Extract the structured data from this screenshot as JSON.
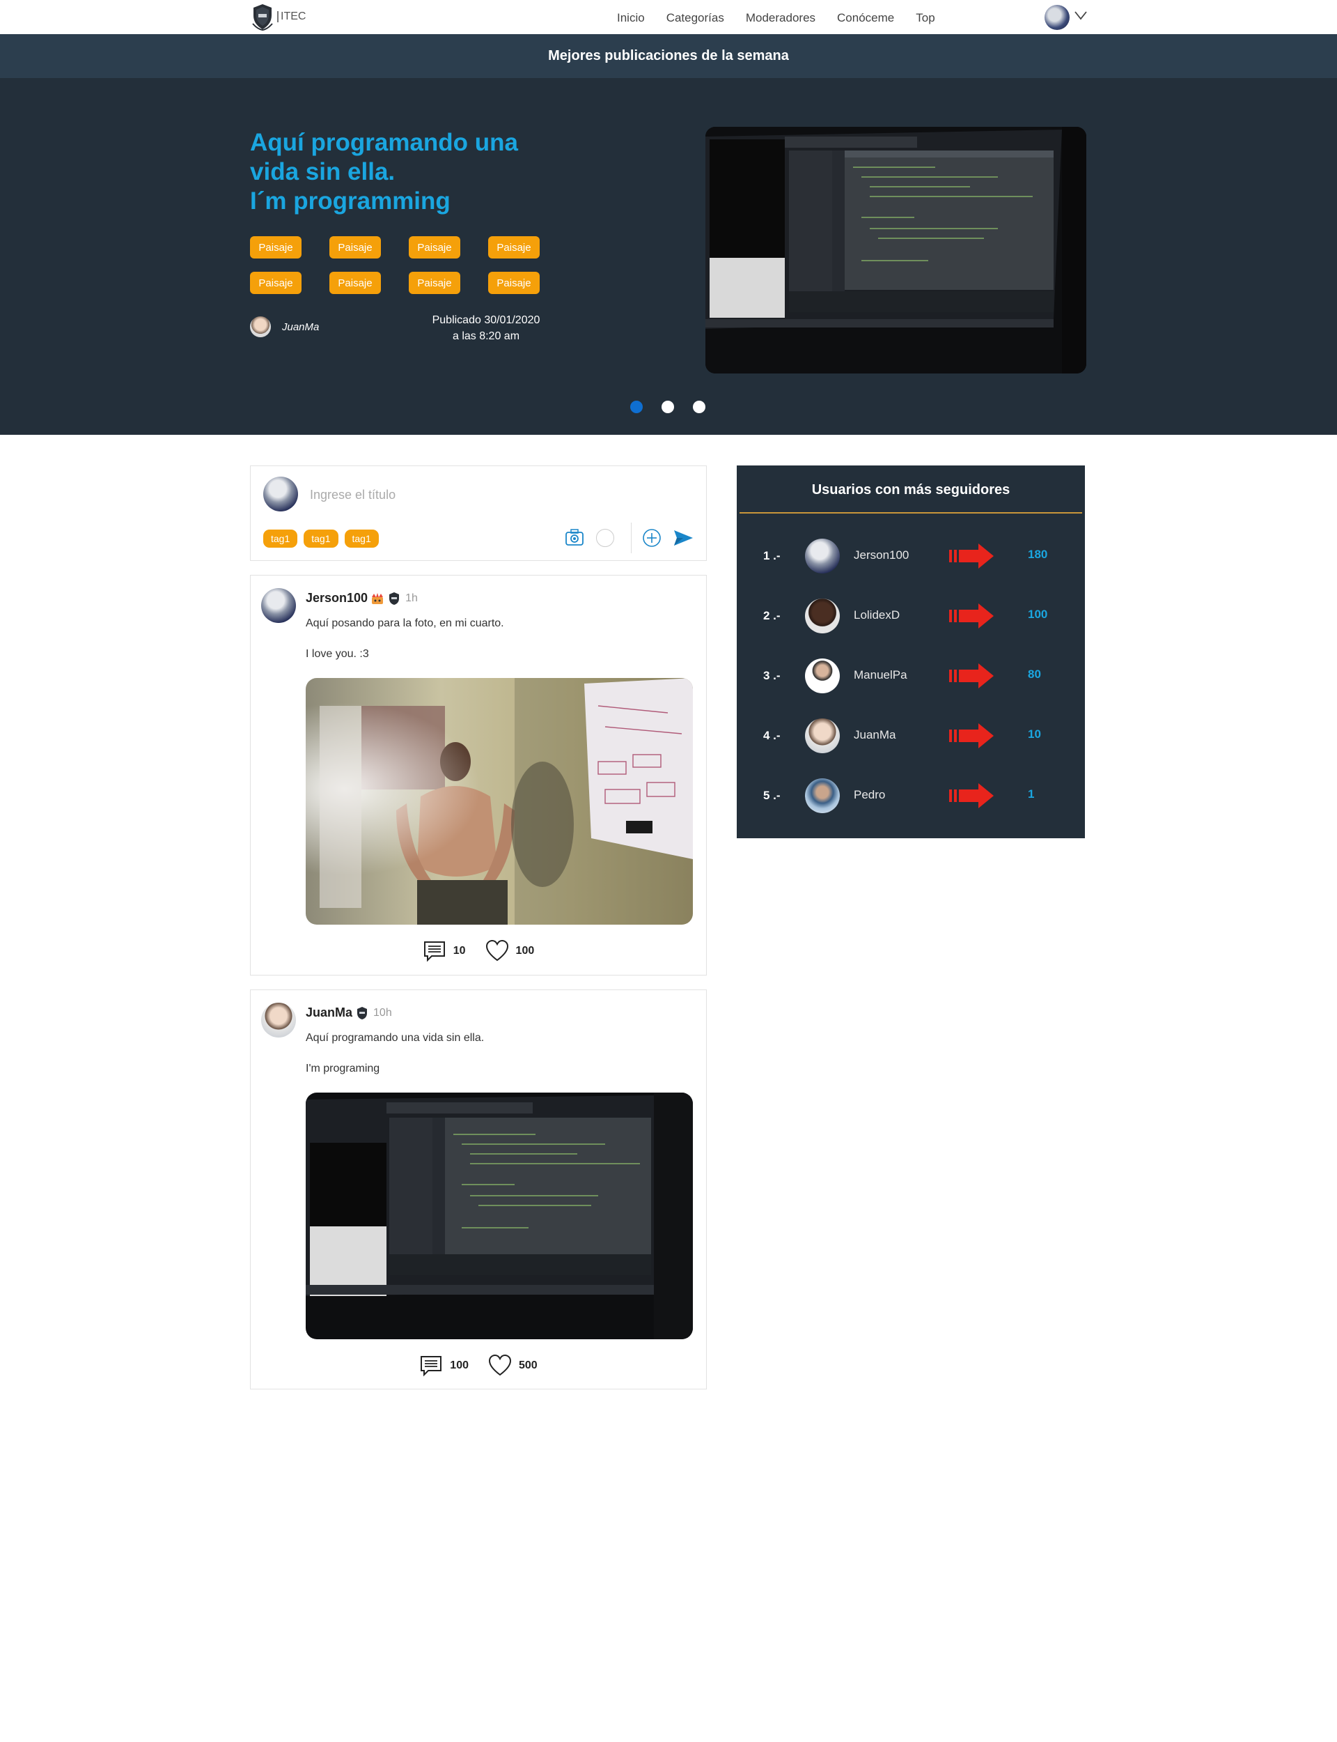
{
  "brand": {
    "logo_text": "ITEC"
  },
  "nav": {
    "links": [
      "Inicio",
      "Categorías",
      "Moderadores",
      "Conóceme",
      "Top"
    ]
  },
  "hero": {
    "bar_title": "Mejores publicaciones de la semana",
    "title_lines": [
      "Aquí programando una",
      "vida sin ella.",
      "I´m programming"
    ],
    "tags": [
      "Paisaje",
      "Paisaje",
      "Paisaje",
      "Paisaje",
      "Paisaje",
      "Paisaje",
      "Paisaje",
      "Paisaje"
    ],
    "author": "JuanMa",
    "date_line1": "Publicado 30/01/2020",
    "date_line2": "a las 8:20 am",
    "slides_count": 3,
    "active_slide": 1
  },
  "composer": {
    "placeholder": "Ingrese el título",
    "tags": [
      "tag1",
      "tag1",
      "tag1"
    ]
  },
  "posts": [
    {
      "user": "Jerson100",
      "time": "1h",
      "line1": "Aquí posando para la foto, en mi cuarto.",
      "line2": "I love you.  :3",
      "comments": "10",
      "likes": "100"
    },
    {
      "user": "JuanMa",
      "time": "10h",
      "line1": "Aquí programando una vida sin ella.",
      "line2": "I'm programing",
      "comments": "100",
      "likes": "500"
    }
  ],
  "sidebar": {
    "title": "Usuarios con más seguidores",
    "ranking": [
      {
        "pos": "1 .-",
        "name": "Jerson100",
        "value": "180"
      },
      {
        "pos": "2 .-",
        "name": "LolidexD",
        "value": "100"
      },
      {
        "pos": "3 .-",
        "name": "ManuelPa",
        "value": "80"
      },
      {
        "pos": "4 .-",
        "name": "JuanMa",
        "value": "10"
      },
      {
        "pos": "5 .-",
        "name": "Pedro",
        "value": "1"
      }
    ]
  },
  "colors": {
    "accent_blue": "#1aa6e0",
    "tag_orange": "#f5a00a",
    "dark_panel": "#232f3a",
    "arrow_red": "#e8241c"
  }
}
